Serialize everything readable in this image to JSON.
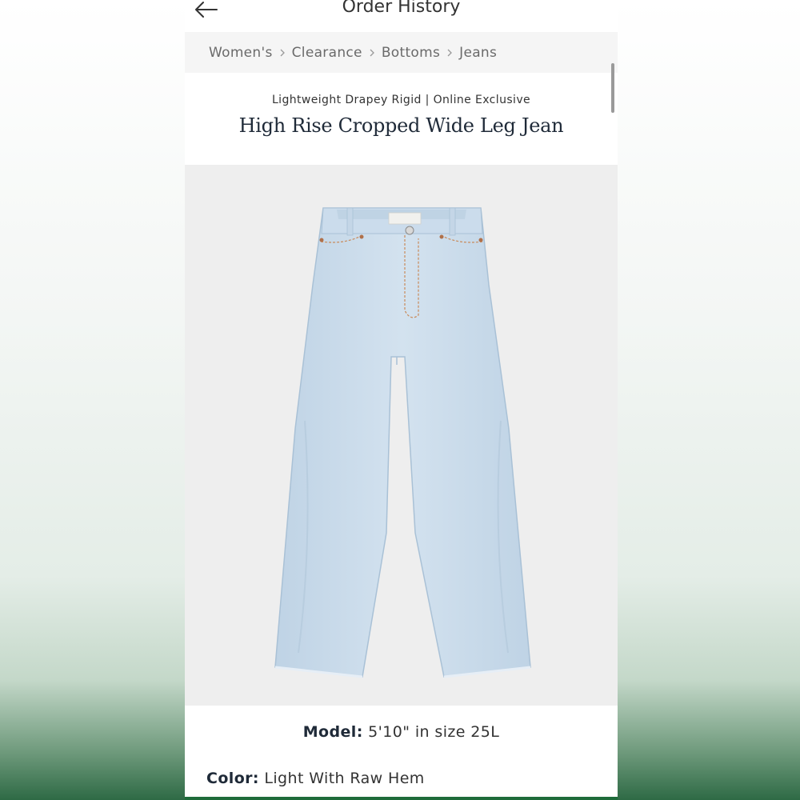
{
  "header": {
    "title": "Order History",
    "back_icon": "arrow-left-icon"
  },
  "breadcrumb": {
    "items": [
      "Women's",
      "Clearance",
      "Bottoms",
      "Jeans"
    ],
    "separator_icon": "chevron-right-icon"
  },
  "product": {
    "subtitle": "Lightweight Drapey Rigid | Online Exclusive",
    "name": "High Rise Cropped Wide Leg Jean",
    "image_alt": "light wash wide leg jeans",
    "model_label": "Model:",
    "model_value": "5'10\" in size 25L",
    "color_label": "Color:",
    "color_value": "Light With Raw Hem"
  },
  "colors": {
    "denim": "#c9dbea",
    "denim_shadow": "#b3c9dc",
    "stitch": "#c98a5a",
    "brand_green": "#1e6b3a"
  }
}
